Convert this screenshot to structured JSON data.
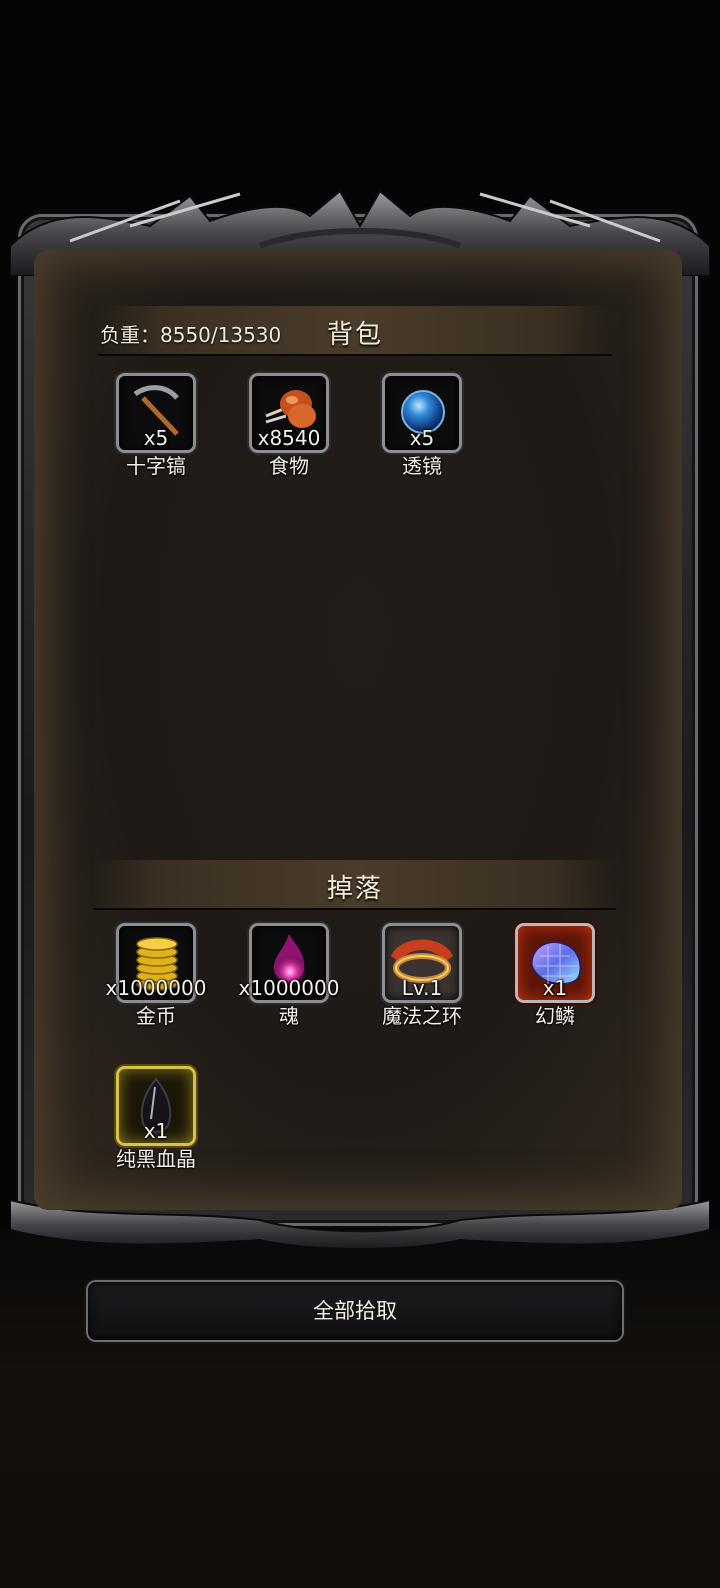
{
  "backpack": {
    "title": "背包",
    "weight_label": "负重：8550/13530",
    "items": [
      {
        "icon": "pickaxe-icon",
        "qty": "x5",
        "name": "十字镐"
      },
      {
        "icon": "food-meat-icon",
        "qty": "x8540",
        "name": "食物"
      },
      {
        "icon": "lens-orb-icon",
        "qty": "x5",
        "name": "透镜"
      }
    ]
  },
  "drops": {
    "title": "掉落",
    "items": [
      {
        "icon": "gold-coins-icon",
        "qty": "x1000000",
        "name": "金币"
      },
      {
        "icon": "soul-flame-icon",
        "qty": "x1000000",
        "name": "魂"
      },
      {
        "icon": "magic-ring-icon",
        "qty": "Lv.1",
        "name": "魔法之环"
      },
      {
        "icon": "phantom-scale-icon",
        "qty": "x1",
        "name": "幻鳞"
      },
      {
        "icon": "black-blood-crystal-icon",
        "qty": "x1",
        "name": "纯黑血晶"
      }
    ]
  },
  "actions": {
    "collect_all": "全部拾取"
  }
}
